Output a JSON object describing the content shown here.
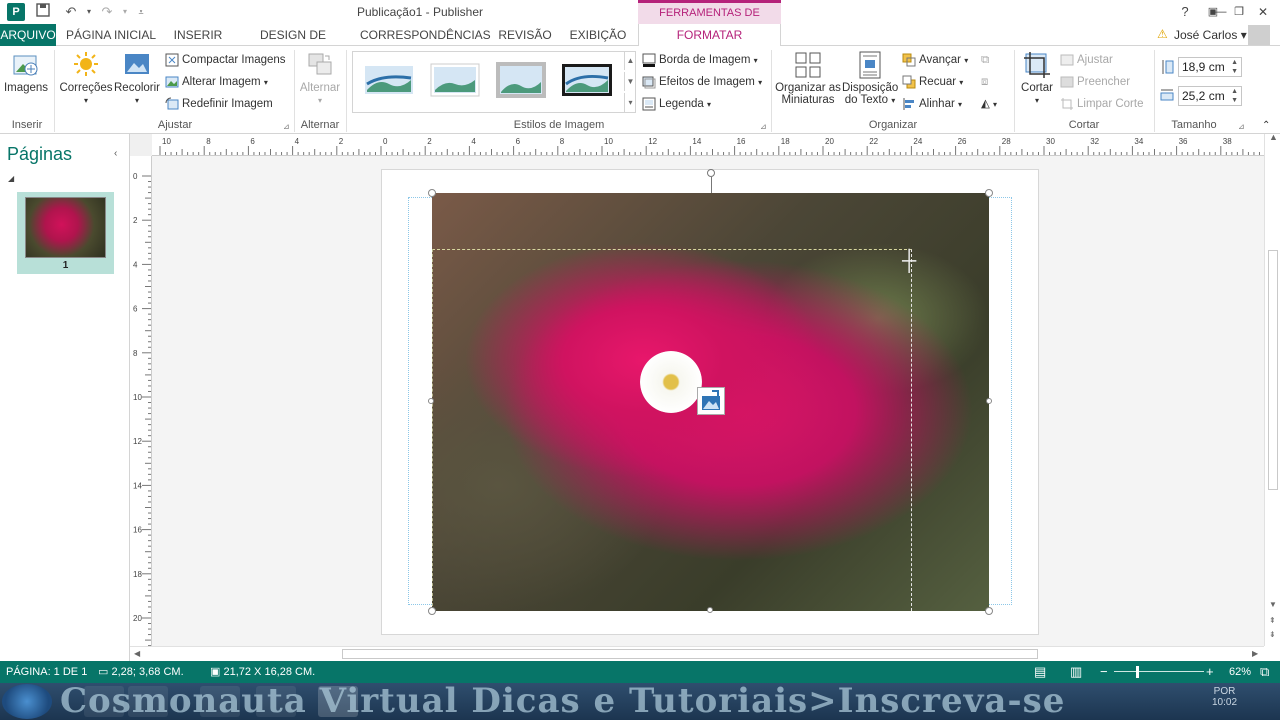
{
  "app": {
    "title": "Publicação1 - Publisher",
    "logo": "P"
  },
  "titlebar": {
    "context_group": "FERRAMENTAS DE IMAGEM",
    "help": "?",
    "ribbon_opts": "▣",
    "minimize": "—",
    "restore": "❐",
    "close": "✕"
  },
  "tabs": [
    {
      "label": "ARQUIVO"
    },
    {
      "label": "PÁGINA INICIAL"
    },
    {
      "label": "INSERIR"
    },
    {
      "label": "DESIGN DE PÁGINA"
    },
    {
      "label": "CORRESPONDÊNCIAS"
    },
    {
      "label": "REVISÃO"
    },
    {
      "label": "EXIBIÇÃO"
    },
    {
      "label": "FORMATAR"
    }
  ],
  "user": {
    "name": "José Carlos"
  },
  "ribbon": {
    "insert": {
      "images": "Imagens",
      "group": "Inserir"
    },
    "adjust": {
      "corrections": "Correções",
      "recolor": "Recolorir",
      "compress": "Compactar Imagens",
      "change": "Alterar Imagem",
      "reset": "Redefinir Imagem",
      "group": "Ajustar"
    },
    "swap": {
      "label": "Alternar",
      "group": "Alternar"
    },
    "styles": {
      "group": "Estilos de Imagem",
      "border": "Borda de Imagem",
      "effects": "Efeitos de Imagem",
      "caption": "Legenda"
    },
    "arrange": {
      "thumbnails_1": "Organizar as",
      "thumbnails_2": "Miniaturas",
      "wrap_1": "Disposição",
      "wrap_2": "do Texto",
      "forward": "Avançar",
      "backward": "Recuar",
      "align": "Alinhar",
      "group": "Organizar"
    },
    "crop": {
      "crop": "Cortar",
      "fit": "Ajustar",
      "fill": "Preencher",
      "clear": "Limpar Corte",
      "group": "Cortar"
    },
    "size": {
      "height": "18,9 cm",
      "width": "25,2 cm",
      "group": "Tamanho"
    }
  },
  "pages_pane": {
    "title": "Páginas",
    "page_number": "1"
  },
  "ruler_h": [
    "10",
    "8",
    "6",
    "4",
    "2",
    "0",
    "2",
    "4",
    "6",
    "8",
    "10",
    "12",
    "14",
    "16",
    "18",
    "20",
    "22",
    "24",
    "26",
    "28",
    "30",
    "32",
    "34",
    "36",
    "38"
  ],
  "ruler_v": [
    "0",
    "2",
    "4",
    "6",
    "8",
    "10",
    "12",
    "14",
    "16",
    "18",
    "20"
  ],
  "status": {
    "page": "PÁGINA: 1 DE 1",
    "position": "2,28; 3,68 CM.",
    "size": "21,72 X 16,28 CM.",
    "zoom": "62%"
  },
  "taskbar": {
    "watermark": "Cosmonauta Virtual Dicas e Tutoriais>Inscreva-se",
    "time": "10:02",
    "lang": "POR"
  },
  "colors": {
    "accent": "#077568",
    "context": "#b5227a",
    "context_bg": "#f2dbe9"
  }
}
